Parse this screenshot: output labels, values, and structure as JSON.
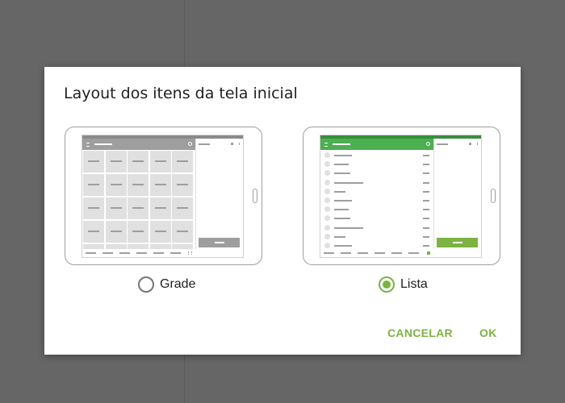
{
  "dialog": {
    "title": "Layout dos itens da tela inicial",
    "options": [
      {
        "label": "Grade",
        "selected": false
      },
      {
        "label": "Lista",
        "selected": true
      }
    ],
    "buttons": {
      "cancel": "CANCELAR",
      "ok": "OK"
    }
  },
  "colors": {
    "accent": "#7cb342",
    "grid_app_bar": "#9e9e9e",
    "list_app_bar": "#4caf50",
    "overlay": "#666666"
  },
  "icons": [
    "tablet-icon",
    "home-button-icon",
    "radio-unchecked-icon",
    "radio-checked-icon"
  ]
}
